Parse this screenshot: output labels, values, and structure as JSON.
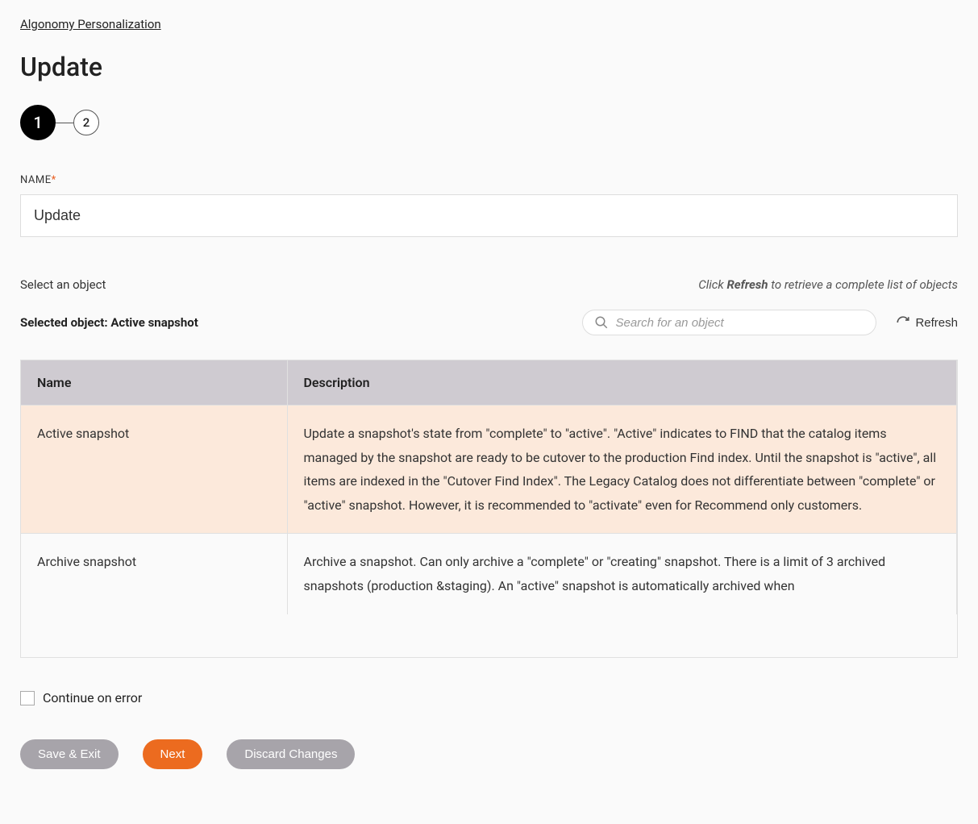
{
  "breadcrumb": "Algonomy Personalization",
  "page_title": "Update",
  "stepper": {
    "step1": "1",
    "step2": "2"
  },
  "name_field": {
    "label": "NAME",
    "value": "Update"
  },
  "select_section": {
    "label": "Select an object",
    "hint_prefix": "Click ",
    "hint_bold": "Refresh",
    "hint_suffix": " to retrieve a complete list of objects",
    "selected_prefix": "Selected object: ",
    "selected_value": "Active snapshot",
    "search_placeholder": "Search for an object",
    "refresh_label": "Refresh"
  },
  "table": {
    "headers": {
      "name": "Name",
      "description": "Description"
    },
    "rows": [
      {
        "name": "Active snapshot",
        "description": "Update a snapshot's state from \"complete\" to \"active\". \"Active\" indicates to FIND that the catalog items managed by the snapshot are ready to be cutover to the production Find index. Until the snapshot is \"active\", all items are indexed in the \"Cutover Find Index\". The Legacy Catalog does not differentiate between \"complete\" or \"active\" snapshot. However, it is recommended to \"activate\" even for Recommend only customers.",
        "selected": true
      },
      {
        "name": "Archive snapshot",
        "description": "Archive a snapshot. Can only archive a \"complete\" or \"creating\" snapshot. There is a limit of 3 archived snapshots (production &staging). An \"active\" snapshot is automatically archived when",
        "selected": false
      }
    ]
  },
  "continue_on_error": "Continue on error",
  "buttons": {
    "save_exit": "Save & Exit",
    "next": "Next",
    "discard": "Discard Changes"
  }
}
